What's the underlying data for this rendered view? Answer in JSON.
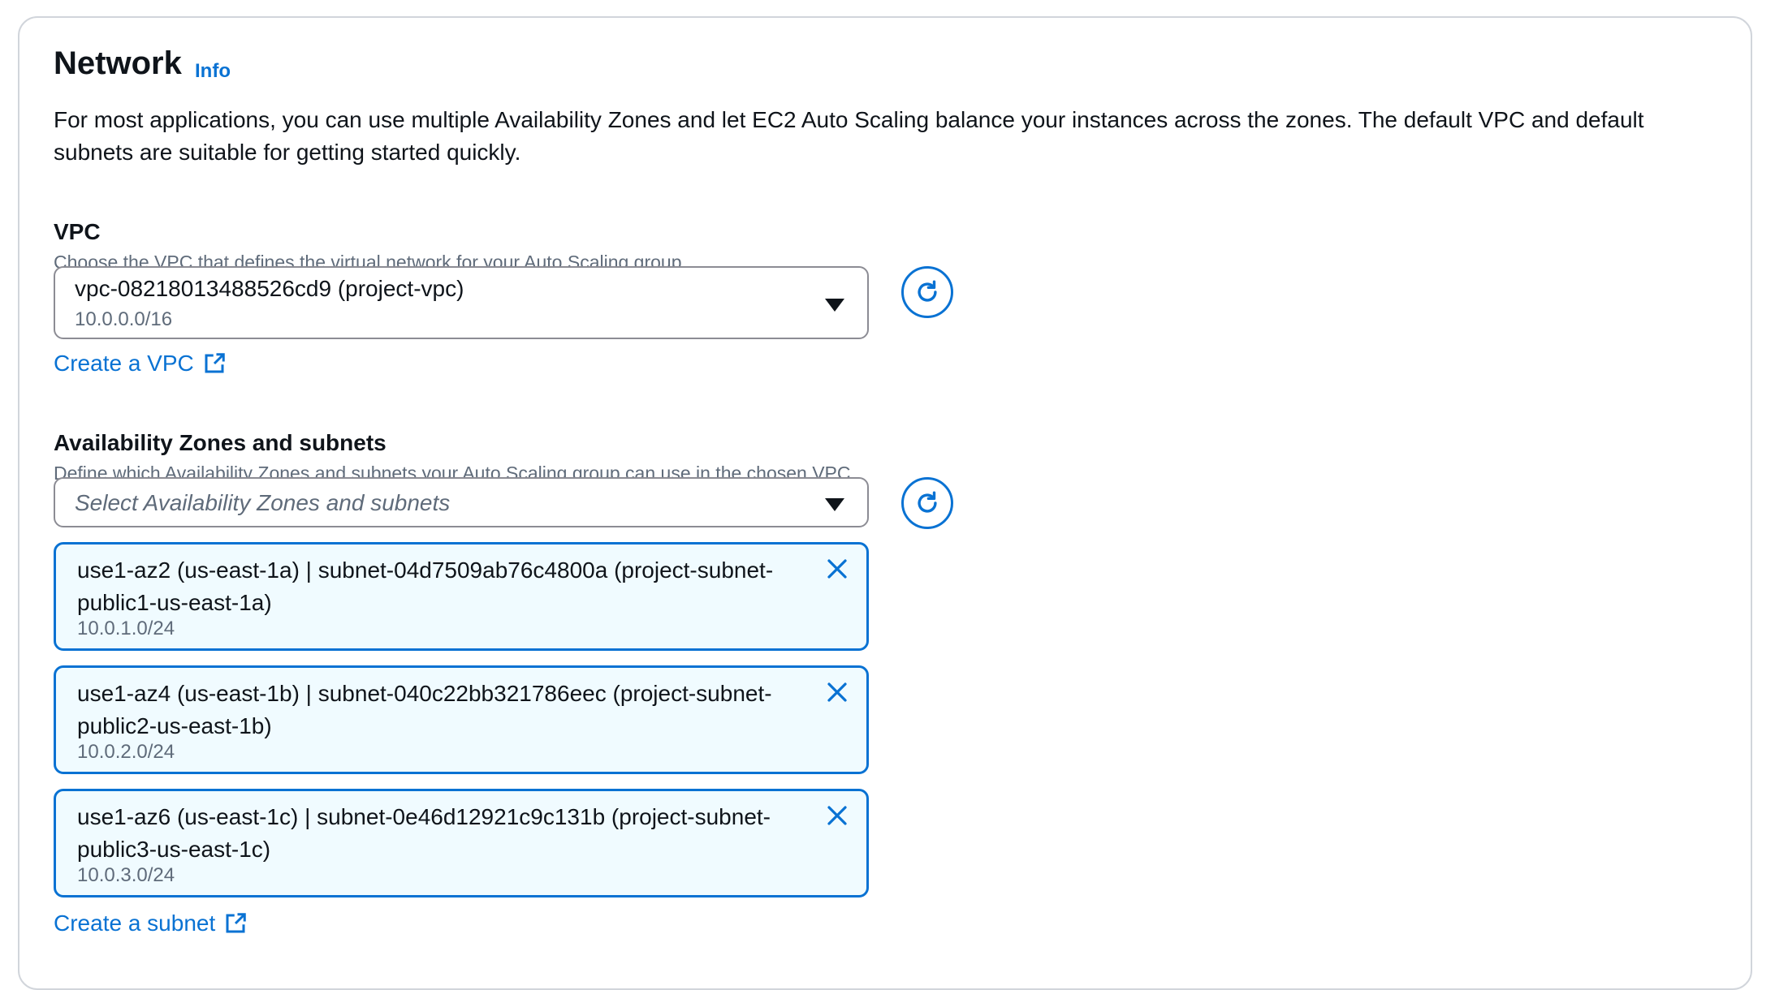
{
  "network": {
    "title": "Network",
    "info_link": "Info",
    "description": "For most applications, you can use multiple Availability Zones and let EC2 Auto Scaling balance your instances across the zones. The default VPC and default subnets are suitable for getting started quickly."
  },
  "vpc": {
    "label": "VPC",
    "sublabel": "Choose the VPC that defines the virtual network for your Auto Scaling group.",
    "selected_value": "vpc-08218013488526cd9 (project-vpc)",
    "selected_cidr": "10.0.0.0/16",
    "create_link": "Create a VPC"
  },
  "subnets": {
    "label": "Availability Zones and subnets",
    "sublabel": "Define which Availability Zones and subnets your Auto Scaling group can use in the chosen VPC.",
    "placeholder": "Select Availability Zones and subnets",
    "tokens": [
      {
        "name": "use1-az2 (us-east-1a) | subnet-04d7509ab76c4800a (project-subnet-public1-us-east-1a)",
        "cidr": "10.0.1.0/24"
      },
      {
        "name": "use1-az4 (us-east-1b) | subnet-040c22bb321786eec (project-subnet-public2-us-east-1b)",
        "cidr": "10.0.2.0/24"
      },
      {
        "name": "use1-az6 (us-east-1c) | subnet-0e46d12921c9c131b (project-subnet-public3-us-east-1c)",
        "cidr": "10.0.3.0/24"
      }
    ],
    "create_link": "Create a subnet"
  },
  "icons": {
    "refresh": "refresh-icon",
    "external": "external-link-icon",
    "dropdown": "caret-down-icon",
    "remove": "close-icon"
  },
  "colors": {
    "accent": "#0972d3",
    "token_bg": "#f0fbff",
    "muted_text": "#5f6b7a"
  }
}
